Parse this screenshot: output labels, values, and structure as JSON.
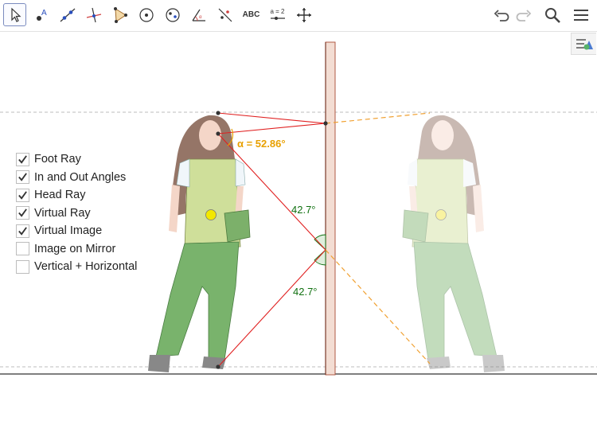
{
  "toolbar": {
    "tools": [
      {
        "name": "move-tool",
        "icon": "cursor-icon",
        "active": true
      },
      {
        "name": "point-tool",
        "icon": "point-icon"
      },
      {
        "name": "line-tool",
        "icon": "line-icon"
      },
      {
        "name": "perpendicular-line-tool",
        "icon": "perpendicular-icon"
      },
      {
        "name": "polygon-tool",
        "icon": "polygon-icon"
      },
      {
        "name": "circle-tool",
        "icon": "circle-icon"
      },
      {
        "name": "circle-through-points-tool",
        "icon": "circle-points-icon"
      },
      {
        "name": "angle-tool",
        "icon": "angle-icon"
      },
      {
        "name": "reflect-tool",
        "icon": "reflect-icon"
      },
      {
        "name": "text-tool",
        "label": "ABC"
      },
      {
        "name": "slider-tool",
        "label": "a = 2"
      },
      {
        "name": "move-graphics-view-tool",
        "icon": "move-view-icon"
      }
    ],
    "undo_icon": "undo-icon",
    "redo_icon": "redo-icon",
    "search_icon": "search-icon",
    "menu_icon": "menu-icon",
    "style_bar_icon": "style-bar-icon"
  },
  "checkboxes": [
    {
      "label": "Foot Ray",
      "checked": true
    },
    {
      "label": "In and Out Angles",
      "checked": true
    },
    {
      "label": "Head Ray",
      "checked": true
    },
    {
      "label": "Virtual Ray",
      "checked": true
    },
    {
      "label": "Virtual Image",
      "checked": true
    },
    {
      "label": "Image on Mirror",
      "checked": false
    },
    {
      "label": "Vertical + Horizontal",
      "checked": false
    }
  ],
  "labels": {
    "alpha": "α = 52.86°",
    "angle_in": "42.7°",
    "angle_out": "42.7°"
  },
  "colors": {
    "ray": "#e02020",
    "virtual_ray": "#f0a030",
    "alpha": "#e8a000",
    "angle": "#107010",
    "mirror_fill": "#f3ddd3",
    "mirror_stroke": "#b25a45",
    "center_point": "#f2e800"
  }
}
